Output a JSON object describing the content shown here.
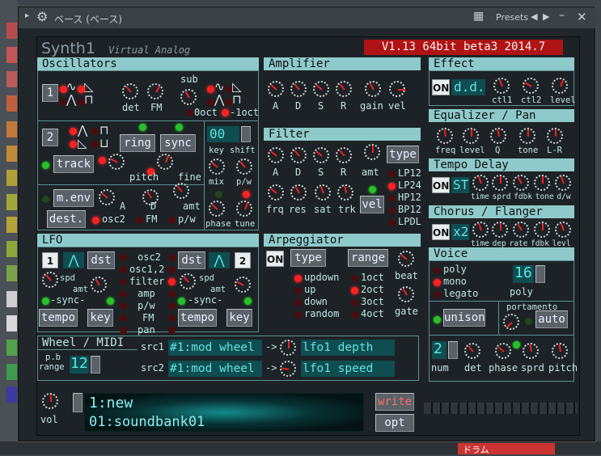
{
  "window": {
    "title": "ベース (ベース)",
    "presets": "Presets"
  },
  "synth": {
    "name": "Synth1",
    "subtitle": "Virtual Analog",
    "version": "V1.13 64bit beta3 2014.7"
  },
  "sections": {
    "oscillators": "Oscillators",
    "amplifier": "Amplifier",
    "effect": "Effect",
    "equalizer": "Equalizer / Pan",
    "filter": "Filter",
    "tempo_delay": "Tempo Delay",
    "chorus": "Chorus / Flanger",
    "lfo": "LFO",
    "arpeggiator": "Arpeggiator",
    "voice": "Voice",
    "wheel": "Wheel / MIDI"
  },
  "osc": {
    "osc1": "1",
    "osc2": "2",
    "det": "det",
    "fm": "FM",
    "sub": "sub",
    "oct0": "0oct",
    "oct_neg1": "-1oct",
    "ring": "ring",
    "sync": "sync",
    "track": "track",
    "pitch": "pitch",
    "fine": "fine",
    "key_shift_value": "00",
    "key": "key",
    "shift": "shift",
    "mix": "mix",
    "pw": "p/w",
    "phase": "phase",
    "tune": "tune",
    "menv": "m.env",
    "A": "A",
    "D": "D",
    "amt": "amt",
    "dest": "dest.",
    "osc2_label": "osc2",
    "fm_label": "FM",
    "pw_label": "p/w"
  },
  "amp": {
    "A": "A",
    "D": "D",
    "S": "S",
    "R": "R",
    "gain": "gain",
    "vel": "vel"
  },
  "effect": {
    "on": "ON",
    "type": "d.d.",
    "ctl1": "ctl1",
    "ctl2": "ctl2",
    "level": "level"
  },
  "eq": {
    "freq": "freq",
    "level": "level",
    "q": "Q",
    "tone": "tone",
    "lr": "L-R"
  },
  "delay": {
    "on": "ON",
    "type": "ST",
    "labels": "time sprd fdbk tone d/w"
  },
  "chorus": {
    "on": "ON",
    "type": "x2",
    "labels": "time dep rate fdbk levl"
  },
  "filter": {
    "type": "type",
    "A": "A",
    "D": "D",
    "S": "S",
    "R": "R",
    "amt": "amt",
    "frq": "frq",
    "res": "res",
    "sat": "sat",
    "trk": "trk",
    "vel": "vel",
    "types": [
      "LP12",
      "LP24",
      "HP12",
      "BP12",
      "LPDL"
    ]
  },
  "lfo": {
    "lfo1": "1",
    "lfo2": "2",
    "dst": "dst",
    "spd": "spd",
    "amt": "amt",
    "sync": "-sync-",
    "tempo": "tempo",
    "key": "key",
    "dests": [
      "osc2",
      "osc1,2",
      "filter",
      "amp",
      "p/w",
      "FM",
      "pan"
    ]
  },
  "arp": {
    "on": "ON",
    "type": "type",
    "range": "range",
    "beat": "beat",
    "gate": "gate",
    "modes": [
      "updown",
      "up",
      "down",
      "random"
    ],
    "octs": [
      "1oct",
      "2oct",
      "3oct",
      "4oct"
    ]
  },
  "voice": {
    "modes": [
      "poly",
      "mono",
      "legato"
    ],
    "poly_value": "16",
    "poly": "poly",
    "portamento": "portamento",
    "unison": "unison",
    "auto": "auto",
    "num_value": "2",
    "num": "num",
    "det": "det",
    "phase": "phase",
    "sprd": "sprd",
    "pitch": "pitch"
  },
  "wheel": {
    "pb": "p.b",
    "range": "range",
    "range_value": "12",
    "src1": "src1",
    "src2": "src2",
    "src1_value": "#1:mod wheel",
    "src2_value": "#1:mod wheel",
    "arrow": "->",
    "dest1": "lfo1 depth",
    "dest2": "lfo1 speed"
  },
  "bottom": {
    "vol": "vol",
    "patch": "1:new",
    "bank": "01:soundbank01",
    "write": "write",
    "opt": "opt"
  },
  "background": {
    "right_label": "ドラム"
  }
}
